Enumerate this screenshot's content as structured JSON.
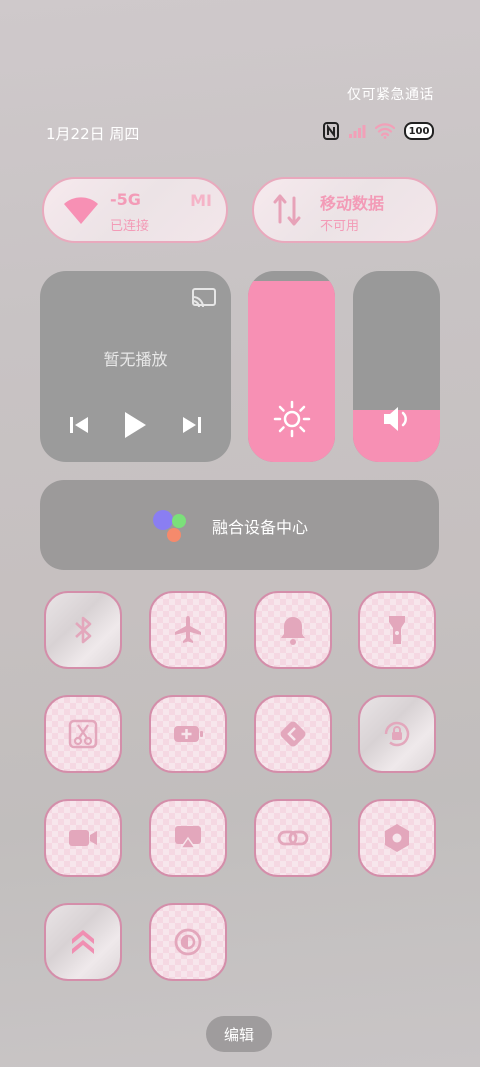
{
  "status": {
    "emergency_text": "仅可紧急通话",
    "date": "1月22日 周四",
    "battery": "100"
  },
  "wifi_pill": {
    "title": "-5G",
    "sub": "已连接",
    "tag": "MI"
  },
  "data_pill": {
    "title": "移动数据",
    "sub": "不可用"
  },
  "media": {
    "title": "暂无播放"
  },
  "sliders": {
    "brightness": 0.95,
    "volume": 0.27
  },
  "fusion": {
    "label": "融合设备中心"
  },
  "tiles": [
    "bluetooth-icon",
    "airplane-icon",
    "bell-icon",
    "flashlight-icon",
    "screenshot-icon",
    "battery-saver-icon",
    "nearby-share-icon",
    "rotation-lock-icon",
    "screen-record-icon",
    "screen-cast-icon",
    "link-icon",
    "settings-hex-icon",
    "chevrons-up-icon",
    "contrast-icon"
  ],
  "edit_label": "编辑",
  "colors": {
    "accent": "#f790b4",
    "tile_border": "#d48eaa",
    "tile_icon": "#e3a7bc"
  }
}
